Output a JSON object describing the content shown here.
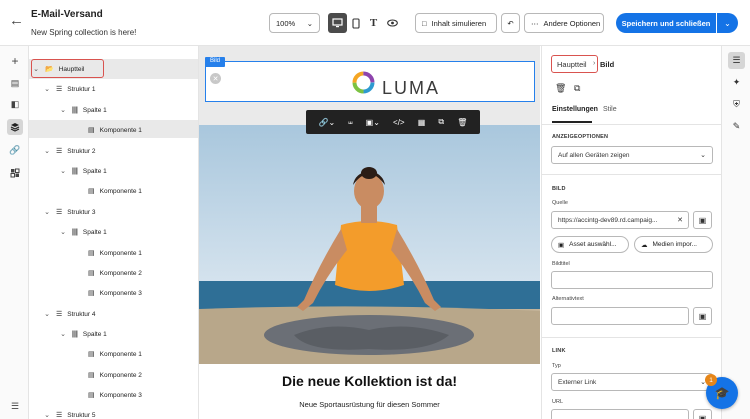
{
  "header": {
    "title": "E-Mail-Versand",
    "subtitle": "New Spring collection is here!",
    "zoom": "100%",
    "simulate_label": "Inhalt simulieren",
    "other_options_label": "Andere Optionen",
    "save_label": "Speichern und schließen"
  },
  "tree": {
    "rows": [
      {
        "label": "Hauptteil",
        "icon": "folder-icon"
      },
      {
        "label": "Struktur 1",
        "icon": "layers-icon"
      },
      {
        "label": "Spalte 1",
        "icon": "columns-icon"
      },
      {
        "label": "Komponente 1",
        "icon": "component-icon"
      },
      {
        "label": "Struktur 2",
        "icon": "layers-icon"
      },
      {
        "label": "Spalte 1",
        "icon": "columns-icon"
      },
      {
        "label": "Komponente 1",
        "icon": "component-icon"
      },
      {
        "label": "Struktur 3",
        "icon": "layers-icon"
      },
      {
        "label": "Spalte 1",
        "icon": "columns-icon"
      },
      {
        "label": "Komponente 1",
        "icon": "component-icon"
      },
      {
        "label": "Komponente 2",
        "icon": "component-icon"
      },
      {
        "label": "Komponente 3",
        "icon": "component-icon"
      },
      {
        "label": "Struktur 4",
        "icon": "layers-icon"
      },
      {
        "label": "Spalte 1",
        "icon": "columns-icon"
      },
      {
        "label": "Komponente 1",
        "icon": "component-icon"
      },
      {
        "label": "Komponente 2",
        "icon": "component-icon"
      },
      {
        "label": "Komponente 3",
        "icon": "component-icon"
      },
      {
        "label": "Struktur 5",
        "icon": "layers-icon"
      }
    ]
  },
  "canvas": {
    "image_tag": "Bild",
    "logo_text": "LUMA",
    "headline": "Die neue Kollektion ist da!",
    "subline": "Neue Sportausrüstung für diesen Sommer"
  },
  "panel": {
    "crumb_parent": "Hauptteil",
    "crumb_current": "Bild",
    "tabs": [
      "Einstellungen",
      "Stile"
    ],
    "display_section": "ANZEIGEOPTIONEN",
    "display_value": "Auf allen Geräten zeigen",
    "image_section": "BILD",
    "source_label": "Quelle",
    "source_value": "https://accintg-dev89.rd.campaig...",
    "select_asset_label": "Asset auswähl...",
    "media_import_label": "Medien impor...",
    "image_title_label": "Bildtitel",
    "alt_text_label": "Alternativtext",
    "link_section": "LINK",
    "type_label": "Typ",
    "type_value": "Externer Link",
    "url_label": "URL"
  },
  "help_badge": "1",
  "colors": {
    "accent": "#1473e6",
    "highlight": "#d9534f",
    "selection": "#2680eb"
  }
}
